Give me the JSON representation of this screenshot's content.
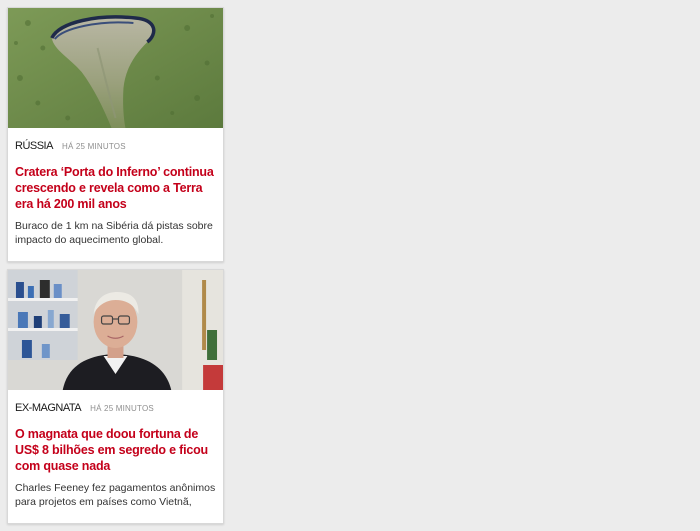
{
  "articles": [
    {
      "section": "RÚSSIA",
      "time": "HÁ 25 MINUTOS",
      "headline": "Cratera ‘Porta do Inferno’ continua crescendo e revela como a Terra era há 200 mil anos",
      "summary": "Buraco de 1 km na Sibéria dá pistas sobre impacto do aquecimento global."
    },
    {
      "section": "EX-MAGNATA",
      "time": "HÁ 25 MINUTOS",
      "headline": "O magnata que doou fortuna de US$ 8 bilhões em segredo e ficou com quase nada",
      "summary": "Charles Feeney fez pagamentos anônimos para projetos em países como Vietnã,"
    }
  ],
  "colors": {
    "headline": "#c4001a",
    "background": "#ececec"
  }
}
